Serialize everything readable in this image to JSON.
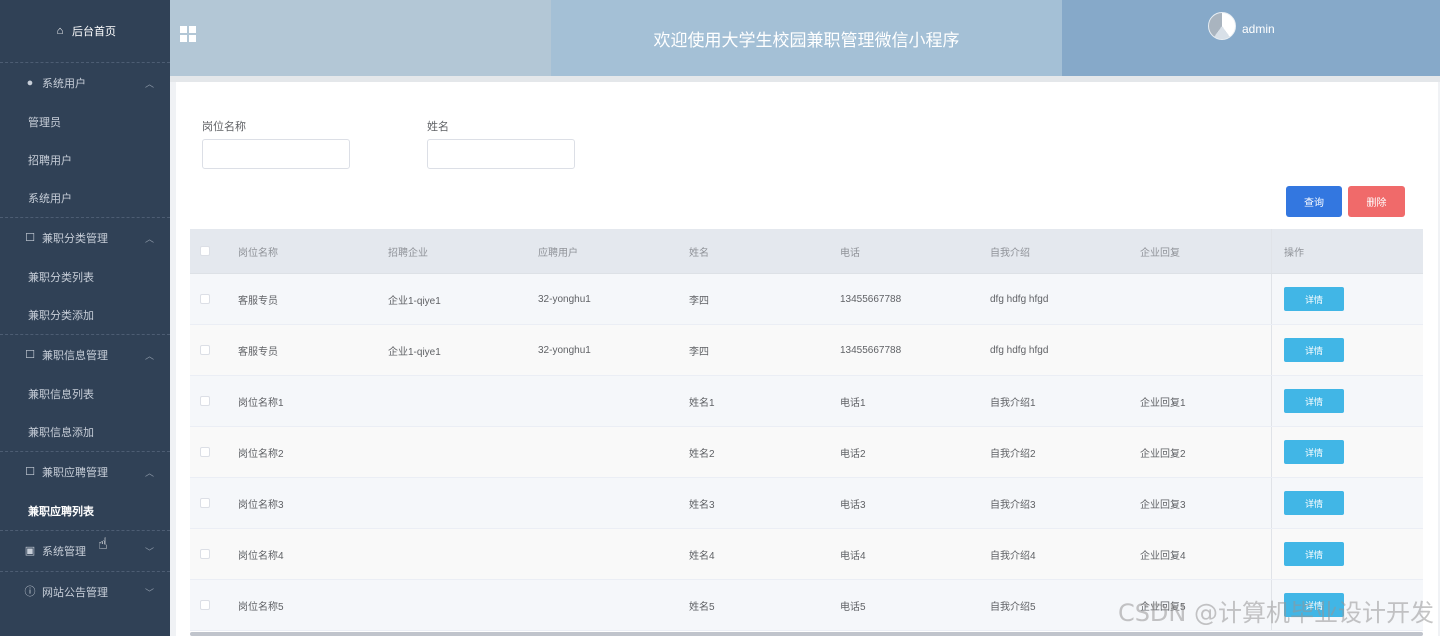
{
  "sidebar": {
    "home_label": "后台首页",
    "groups": [
      {
        "title": "系统用户",
        "items": [
          "管理员",
          "招聘用户",
          "系统用户"
        ]
      },
      {
        "title": "兼职分类管理",
        "items": [
          "兼职分类列表",
          "兼职分类添加"
        ]
      },
      {
        "title": "兼职信息管理",
        "items": [
          "兼职信息列表",
          "兼职信息添加"
        ]
      },
      {
        "title": "兼职应聘管理",
        "items": [
          "兼职应聘列表"
        ]
      },
      {
        "title": "系统管理",
        "items": []
      },
      {
        "title": "网站公告管理",
        "items": []
      }
    ]
  },
  "header": {
    "title": "欢迎使用大学生校园兼职管理微信小程序",
    "username": "admin"
  },
  "filters": {
    "job_label": "岗位名称",
    "name_label": "姓名"
  },
  "buttons": {
    "search": "查询",
    "delete": "删除",
    "detail": "详情"
  },
  "table": {
    "columns": [
      "岗位名称",
      "招聘企业",
      "应聘用户",
      "姓名",
      "电话",
      "自我介绍",
      "企业回复",
      "操作"
    ],
    "rows": [
      [
        "客服专员",
        "企业1-qiye1",
        "32-yonghu1",
        "李四",
        "13455667788",
        "dfg hdfg hfgd",
        ""
      ],
      [
        "客服专员",
        "企业1-qiye1",
        "32-yonghu1",
        "李四",
        "13455667788",
        "dfg hdfg hfgd",
        ""
      ],
      [
        "岗位名称1",
        "",
        "",
        "姓名1",
        "电话1",
        "自我介绍1",
        "企业回复1"
      ],
      [
        "岗位名称2",
        "",
        "",
        "姓名2",
        "电话2",
        "自我介绍2",
        "企业回复2"
      ],
      [
        "岗位名称3",
        "",
        "",
        "姓名3",
        "电话3",
        "自我介绍3",
        "企业回复3"
      ],
      [
        "岗位名称4",
        "",
        "",
        "姓名4",
        "电话4",
        "自我介绍4",
        "企业回复4"
      ],
      [
        "岗位名称5",
        "",
        "",
        "姓名5",
        "电话5",
        "自我介绍5",
        "企业回复5"
      ]
    ]
  },
  "watermark": "CSDN @计算机毕业设计开发"
}
